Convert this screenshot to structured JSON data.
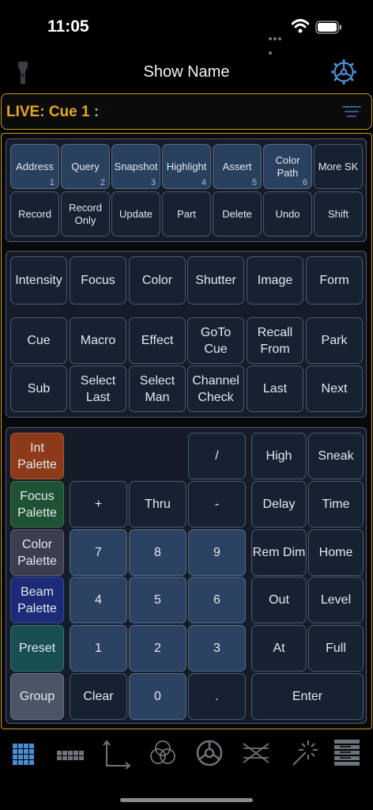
{
  "status_bar": {
    "time": "11:05"
  },
  "header": {
    "title": "Show Name"
  },
  "live": {
    "label": "LIVE: Cue  1 :"
  },
  "softkeys": {
    "row1": [
      {
        "label": "Address",
        "sub": "1"
      },
      {
        "label": "Query",
        "sub": "2"
      },
      {
        "label": "Snapshot",
        "sub": "3"
      },
      {
        "label": "Highlight",
        "sub": "4"
      },
      {
        "label": "Assert",
        "sub": "5"
      },
      {
        "label": "Color Path",
        "sub": "6"
      },
      {
        "label": "More SK"
      }
    ],
    "row2": [
      "Record",
      "Record Only",
      "Update",
      "Part",
      "Delete",
      "Undo",
      "Shift"
    ]
  },
  "parameters": [
    "Intensity",
    "Focus",
    "Color",
    "Shutter",
    "Image",
    "Form"
  ],
  "targets": {
    "row1": [
      "Cue",
      "Macro",
      "Effect",
      "GoTo Cue",
      "Recall From",
      "Park"
    ],
    "row2": [
      "Sub",
      "Select Last",
      "Select Man",
      "Channel Check",
      "Last",
      "Next"
    ]
  },
  "palettes": [
    "Int Palette",
    "Focus Palette",
    "Color Palette",
    "Beam Palette",
    "Preset",
    "Group"
  ],
  "keypad": {
    "slash": "/",
    "plus": "+",
    "thru": "Thru",
    "minus": "-",
    "seven": "7",
    "eight": "8",
    "nine": "9",
    "four": "4",
    "five": "5",
    "six": "6",
    "one": "1",
    "two": "2",
    "three": "3",
    "clear": "Clear",
    "zero": "0",
    "dot": "."
  },
  "command": {
    "high": "High",
    "sneak": "Sneak",
    "delay": "Delay",
    "time": "Time",
    "rem_dim": "Rem Dim",
    "home": "Home",
    "out": "Out",
    "level": "Level",
    "at": "At",
    "full": "Full",
    "enter": "Enter"
  },
  "colors": {
    "accent": "#c99a1a",
    "live_text": "#e6a618",
    "icon_blue": "#4a8fd6"
  },
  "tabs": [
    "keypad-icon",
    "faders-icon",
    "xy-axes-icon",
    "color-mix-icon",
    "wheel-icon",
    "crossfade-icon",
    "magic-sheet-icon",
    "playback-list-icon"
  ]
}
